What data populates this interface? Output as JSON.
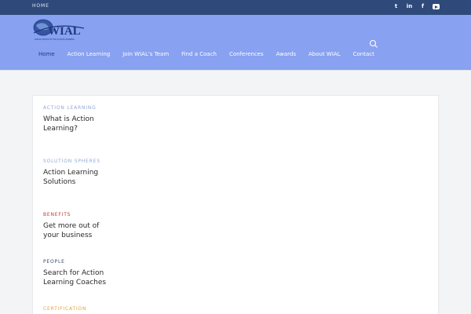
{
  "topbar": {
    "home_label": "HOME",
    "social_icons": [
      "twitter-icon",
      "linkedin-icon",
      "facebook-icon",
      "youtube-icon"
    ],
    "social_glyphs": {
      "twitter": "t",
      "linkedin": "in",
      "facebook": "f"
    }
  },
  "header": {
    "logo_text": "WIAL",
    "logo_tagline": "WORLD INSTITUTE FOR ACTION LEARNING",
    "nav": [
      {
        "label": "Home",
        "active": true
      },
      {
        "label": "Action Learning"
      },
      {
        "label": "Join WIAL's Team"
      },
      {
        "label": "Find a Coach"
      },
      {
        "label": "Conferences"
      },
      {
        "label": "Awards"
      },
      {
        "label": "About WIAL"
      },
      {
        "label": "Contact"
      }
    ]
  },
  "posts": [
    {
      "category": "ACTION LEARNING",
      "title": "What is Action Learning?",
      "category_color": "#90aad3"
    },
    {
      "category": "SOLUTION SPHERES",
      "title": "Action Learning Solutions",
      "category_color": "#90aad3"
    },
    {
      "category": "BENEFITS",
      "title": "Get more out of your business",
      "category_color": "#c0392b"
    },
    {
      "category": "PEOPLE",
      "title": "Search for Action Learning Coaches",
      "category_color": "#3a4a6a"
    },
    {
      "category": "CERTIFICATION",
      "title": "",
      "category_color": "#e0a243"
    }
  ],
  "colors": {
    "topbar": "#2f4a7a",
    "header": "#88a1f0",
    "nav_active": "#1e3a8a",
    "page_bg": "#f3f4f6"
  }
}
